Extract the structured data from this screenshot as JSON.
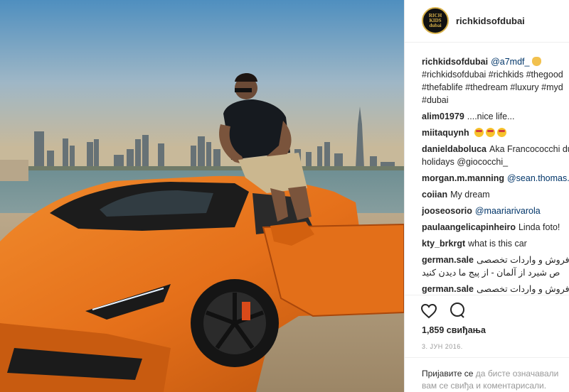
{
  "post": {
    "username": "richkidsofdubai",
    "avatar_text": "RICH KIDS dubai",
    "photo_alt": "Man sitting on an orange Lamborghini with the Dubai skyline behind",
    "caption": {
      "username": "richkidsofdubai",
      "mention": "@a7mdf_",
      "hashtags_line1": "#richkidsofdubai #richkids #thegood",
      "hashtags_line2": "#thefablife #thedream #luxury #myd",
      "hashtags_line3": "#dubai"
    },
    "comments": [
      {
        "user": "alim01979",
        "text": "....nice life..."
      },
      {
        "user": "miitaquynh",
        "text": ""
      },
      {
        "user": "danieldaboluca",
        "text": "Aka Francococchi du",
        "text2": "holidays @giococchi_"
      },
      {
        "user": "morgan.m.manning",
        "text": "@sean.thomas."
      },
      {
        "user": "coiian",
        "text": "My dream"
      },
      {
        "user": "jooseosorio",
        "text": "@maariarivarola"
      },
      {
        "user": "paulaangelicapinheiro",
        "text": "Linda foto!"
      },
      {
        "user": "kty_brkrgt",
        "text": "what is this car"
      },
      {
        "user": "german.sale",
        "text": "فروش و واردات تخصصی",
        "text2": "ص شیرد از آلمان - از پیج ما دیدن کنید"
      },
      {
        "user": "german.sale",
        "text": "فروش و واردات تخصصی"
      }
    ],
    "likes": "1,859 свиђања",
    "date": "3. ЈУН 2016.",
    "login": {
      "link": "Пријавите се",
      "rest1": " да бисте означавали",
      "rest2": "вам се свиђа и коментарисали."
    }
  },
  "icons": [
    "heart-icon",
    "comment-icon",
    "emoji-heart-eyes-icon",
    "emoji-ok-hand-icon"
  ]
}
